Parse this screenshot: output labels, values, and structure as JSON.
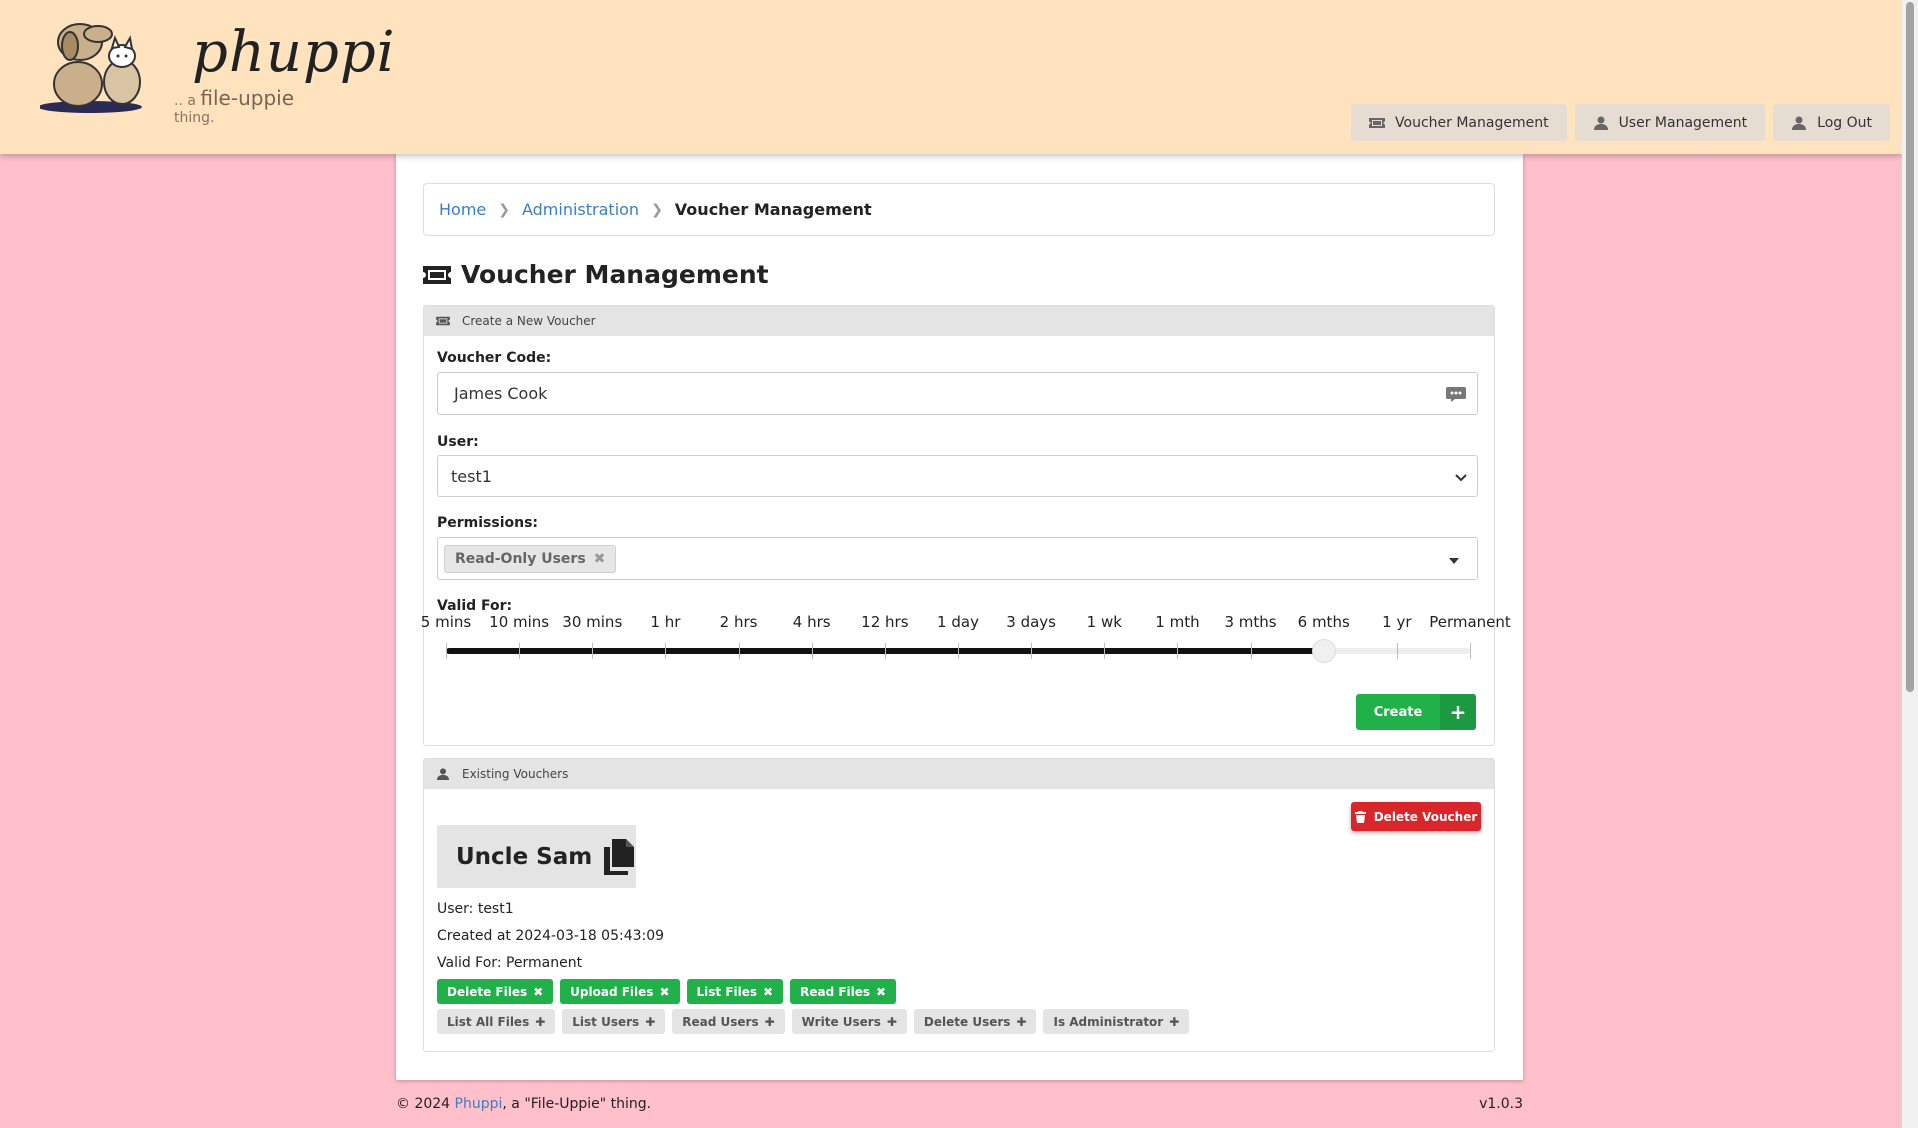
{
  "logo": {
    "word": "phuppi",
    "tagline_prefix": ".. a",
    "tagline_main": "file-uppie",
    "tagline_suffix": "thing."
  },
  "nav": [
    {
      "label": "Voucher Management",
      "icon": "ticket-icon"
    },
    {
      "label": "User Management",
      "icon": "user-icon"
    },
    {
      "label": "Log Out",
      "icon": "user-icon"
    }
  ],
  "breadcrumb": {
    "home": "Home",
    "admin": "Administration",
    "current": "Voucher Management"
  },
  "page_title": "Voucher Management",
  "create_card": {
    "title": "Create a New Voucher",
    "voucher_code_label": "Voucher Code:",
    "voucher_code_value": "James Cook",
    "user_label": "User:",
    "user_value": "test1",
    "permissions_label": "Permissions:",
    "permission_tag": "Read-Only Users",
    "valid_for_label": "Valid For:",
    "durations": [
      "5 mins",
      "10 mins",
      "30 mins",
      "1 hr",
      "2 hrs",
      "4 hrs",
      "12 hrs",
      "1 day",
      "3 days",
      "1 wk",
      "1 mth",
      "3 mths",
      "6 mths",
      "1 yr",
      "Permanent"
    ],
    "selected_duration": "6 mths",
    "selected_index": 12,
    "create_label": "Create",
    "create_plus": "+"
  },
  "existing_card": {
    "title": "Existing Vouchers",
    "delete_label": "Delete Voucher",
    "voucher_code": "Uncle Sam",
    "user": "User: test1",
    "created": "Created at 2024-03-18 05:43:09",
    "valid_for": "Valid For: Permanent",
    "active_permissions": [
      "Delete Files",
      "Upload Files",
      "List Files",
      "Read Files"
    ],
    "inactive_permissions": [
      "List All Files",
      "List Users",
      "Read Users",
      "Write Users",
      "Delete Users",
      "Is Administrator"
    ]
  },
  "footer": {
    "prefix": "© 2024",
    "link": "Phuppi",
    "suffix": ", a \"File-Uppie\" thing.",
    "version": "v1.0.3"
  },
  "colors": {
    "header_bg": "#ffe3bf",
    "page_bg": "#ffbfcb",
    "accent_green": "#21b04a",
    "danger_red": "#d9262b",
    "link_blue": "#3c7fc0"
  }
}
